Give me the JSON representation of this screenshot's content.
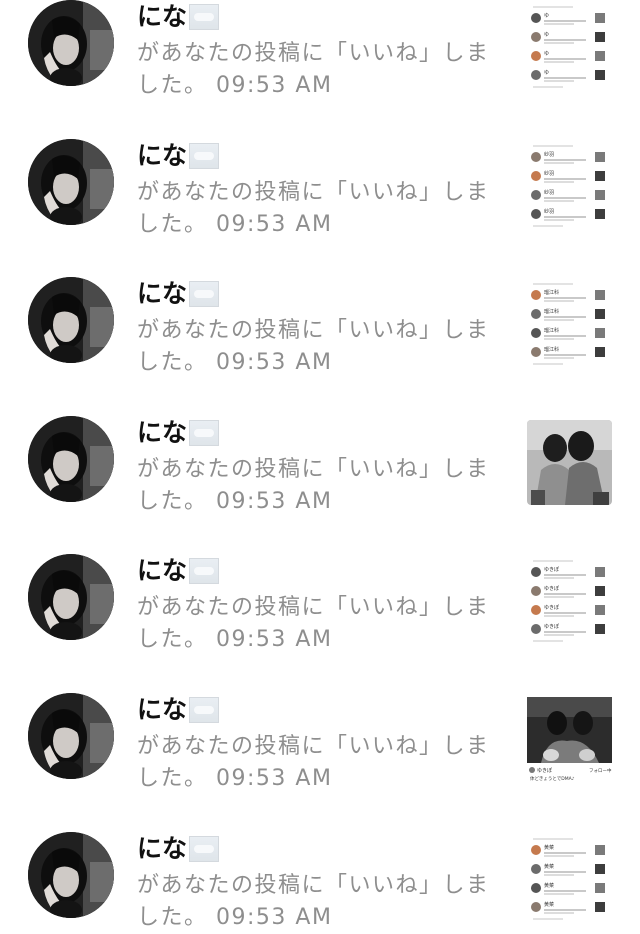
{
  "notifications": [
    {
      "username": "にな",
      "emoji_name": "cloud-icon",
      "message": "があなたの投稿に「いいね」しました。",
      "time": "09:53 AM",
      "thumbnail": "screenshot-list",
      "thumb_names": [
        "ゆ",
        "ゆ",
        "ゆ",
        "ゆ"
      ]
    },
    {
      "username": "にな",
      "emoji_name": "cloud-icon",
      "message": "があなたの投稿に「いいね」しました。",
      "time": "09:53 AM",
      "thumbnail": "screenshot-list",
      "thumb_names": [
        "紗羽",
        "紗羽",
        "紗羽",
        "紗羽"
      ]
    },
    {
      "username": "にな",
      "emoji_name": "cloud-icon",
      "message": "があなたの投稿に「いいね」しました。",
      "time": "09:53 AM",
      "thumbnail": "screenshot-list",
      "thumb_names": [
        "瑠江科",
        "瑠江科",
        "瑠江科",
        "瑠江科"
      ]
    },
    {
      "username": "にな",
      "emoji_name": "cloud-icon",
      "message": "があなたの投稿に「いいね」しました。",
      "time": "09:53 AM",
      "thumbnail": "photo-two-girls",
      "thumb_names": []
    },
    {
      "username": "にな",
      "emoji_name": "cloud-icon",
      "message": "があなたの投稿に「いいね」しました。",
      "time": "09:53 AM",
      "thumbnail": "screenshot-list",
      "thumb_names": [
        "ゆきぽ",
        "ゆきぽ",
        "ゆきぽ",
        "ゆきぽ"
      ]
    },
    {
      "username": "にな",
      "emoji_name": "cloud-icon",
      "message": "があなたの投稿に「いいね」しました。",
      "time": "09:53 AM",
      "thumbnail": "photo-post",
      "thumb_names": [],
      "thumb_handle": "ゆきぽ",
      "thumb_follow": "フォロー中",
      "thumb_caption": "体どきょうとでDMA♪"
    },
    {
      "username": "にな",
      "emoji_name": "cloud-icon",
      "message": "があなたの投稿に「いいね」しました。",
      "time": "09:53 AM",
      "thumbnail": "screenshot-list",
      "thumb_names": [
        "黄菜",
        "黄菜",
        "黄菜",
        "黄菜"
      ]
    }
  ],
  "colors": {
    "name": "#111111",
    "message": "#8e8e8e",
    "background": "#ffffff"
  }
}
